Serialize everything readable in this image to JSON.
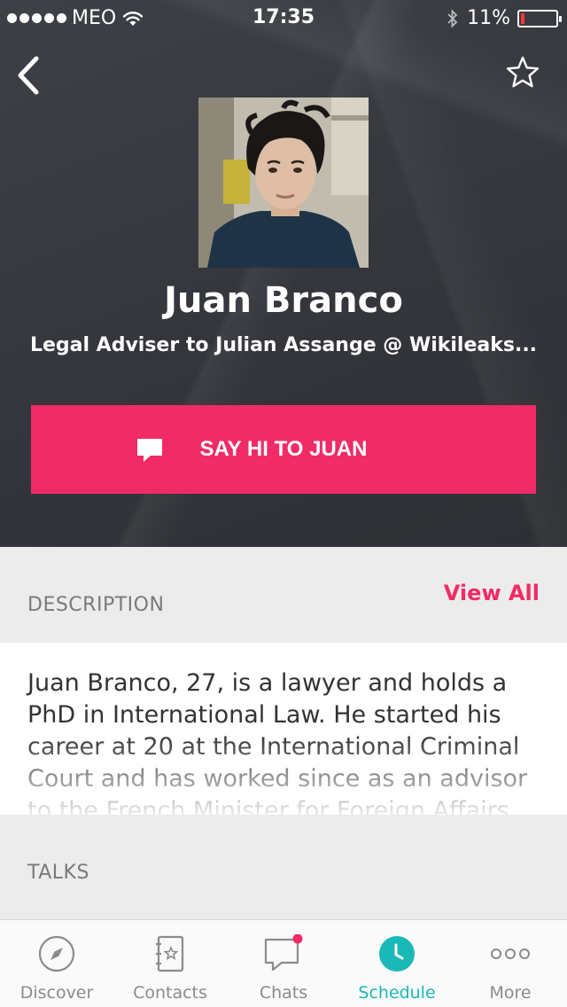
{
  "status_bar": {
    "carrier": "MEO",
    "time": "17:35",
    "battery_percent": "11%",
    "battery_level": 0.11,
    "icons": [
      "signal-dots-icon",
      "wifi-icon",
      "bluetooth-icon",
      "battery-icon"
    ]
  },
  "header": {
    "back_icon": "chevron-left-icon",
    "favorite_icon": "star-outline-icon"
  },
  "profile": {
    "name": "Juan Branco",
    "role": "Legal Adviser to Julian Assange @ Wikileaks..."
  },
  "say_hi_button": {
    "label": "SAY HI TO JUAN",
    "icon": "chat-bubble-icon",
    "color": "#f02b65"
  },
  "description": {
    "title": "DESCRIPTION",
    "view_all_label": "View All",
    "text": "Juan Branco, 27, is a lawyer and holds a PhD in International Law. He started his career at 20 at the International Criminal Court and has worked since as an advisor to the French Minister for Foreign Affairs"
  },
  "talks": {
    "title": "TALKS"
  },
  "tab_bar": {
    "active_color": "#1bb8b8",
    "notification_color": "#f02b65",
    "tabs": [
      {
        "label": "Discover",
        "icon": "compass-icon",
        "active": false
      },
      {
        "label": "Contacts",
        "icon": "address-book-icon",
        "active": false
      },
      {
        "label": "Chats",
        "icon": "chat-icon",
        "active": false,
        "has_notification": true
      },
      {
        "label": "Schedule",
        "icon": "clock-icon",
        "active": true
      },
      {
        "label": "More",
        "icon": "more-dots-icon",
        "active": false
      }
    ]
  },
  "colors": {
    "accent": "#f02b65",
    "teal": "#1bb8b8",
    "hero_bg": "#3a3c42"
  }
}
